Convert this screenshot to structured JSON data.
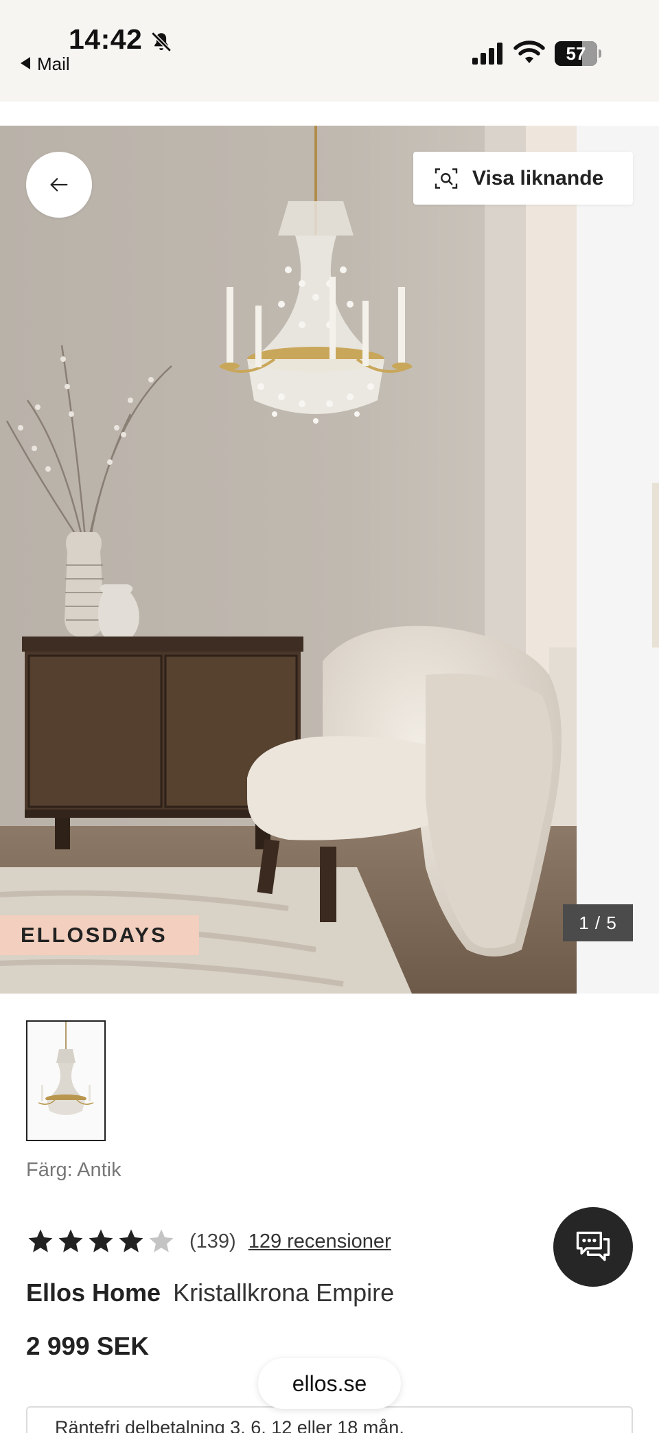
{
  "status_bar": {
    "time": "14:42",
    "back_app": "Mail",
    "battery": "57",
    "icons": [
      "bell-slash-icon",
      "signal-icon",
      "wifi-icon",
      "battery-icon"
    ]
  },
  "hero": {
    "similar_button": "Visa liknande",
    "badge": "ELLOSDAYS",
    "counter": "1 / 5",
    "icons": [
      "arrow-left-icon",
      "visual-search-icon"
    ]
  },
  "product": {
    "color_label": "Färg: Antik",
    "rating_value": 4,
    "rating_max": 5,
    "rating_count": "(139)",
    "reviews_link": "129 recensioner",
    "brand": "Ellos Home",
    "name": "Kristallkrona Empire",
    "price": "2 999 SEK",
    "installment": "Räntefri delbetalning 3, 6, 12 eller 18 mån."
  },
  "browser": {
    "url": "ellos.se"
  },
  "colors": {
    "badge_bg": "#f2cfbe",
    "chat_bg": "#262626",
    "counter_bg": "#4b4b4b",
    "status_bg": "#f6f5f2"
  }
}
